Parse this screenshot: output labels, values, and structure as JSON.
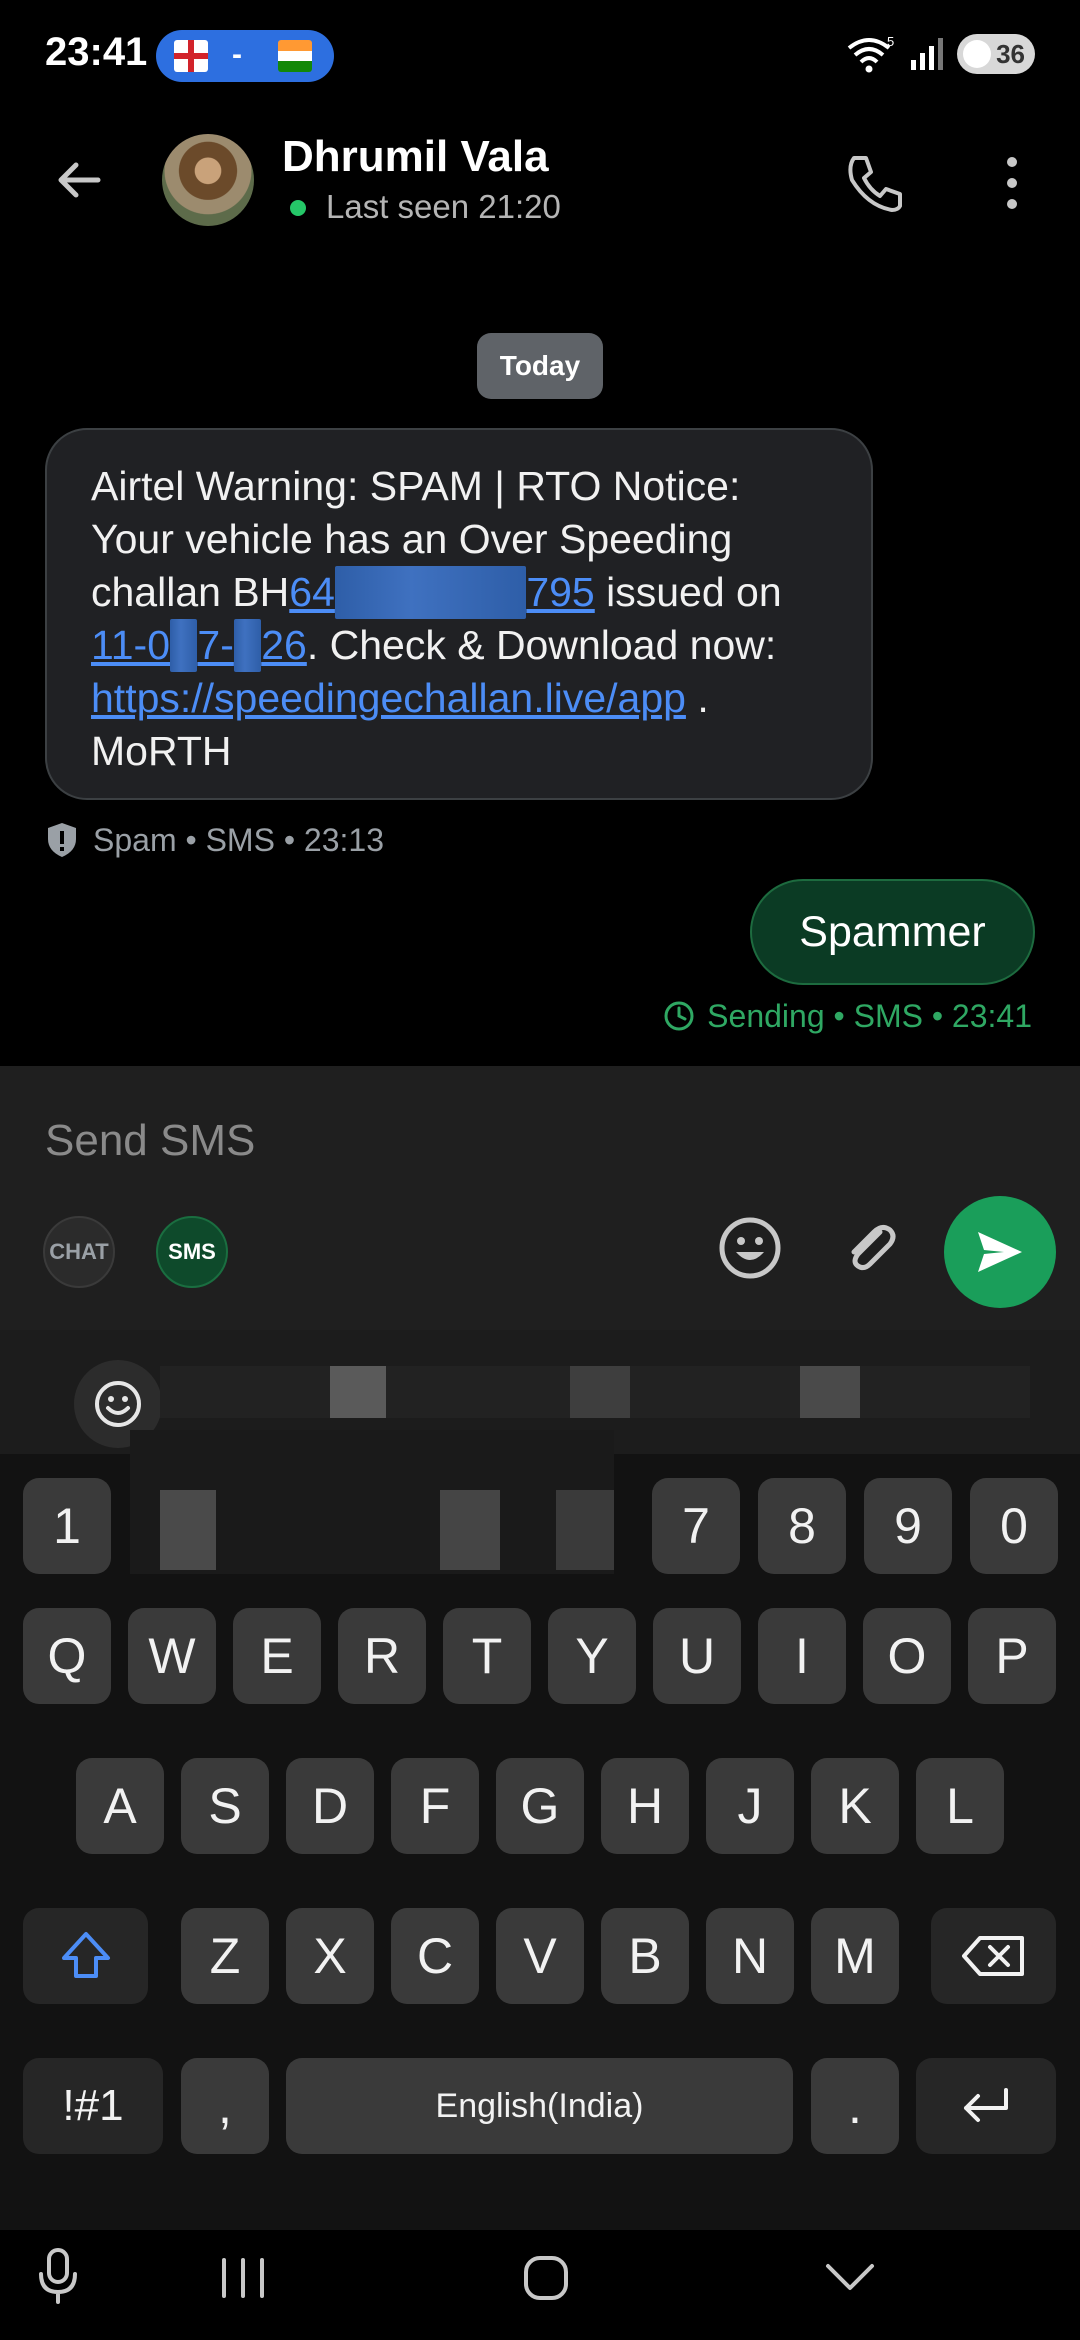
{
  "status_bar": {
    "time": "23:41",
    "match_separator": "-",
    "battery": "36"
  },
  "header": {
    "contact_name": "Dhrumil Vala",
    "last_seen": "Last seen 21:20"
  },
  "chat": {
    "date_chip": "Today",
    "incoming": {
      "line1": "Airtel Warning: SPAM | RTO Notice:",
      "line2": "Your vehicle has an Over Speeding",
      "line3_pre": "challan BH",
      "challan_visible_start": "64",
      "challan_visible_end": "795",
      "line3_post": " issued on",
      "date_visible_start": "11-0",
      "date_visible_mid": "7-",
      "date_visible_end": "26",
      "line4_post": ". Check & Download now:",
      "link": "https://speedingechallan.live/app",
      "link_post": " .",
      "line6": "MoRTH",
      "meta": "Spam • SMS • 23:13"
    },
    "outgoing": {
      "text": "Spammer",
      "meta": "Sending • SMS • 23:41"
    }
  },
  "compose": {
    "placeholder": "Send SMS",
    "chat_chip": "CHAT",
    "sms_chip": "SMS"
  },
  "keyboard": {
    "number_row": [
      "1",
      "7",
      "8",
      "9",
      "0"
    ],
    "row1": [
      "Q",
      "W",
      "E",
      "R",
      "T",
      "Y",
      "U",
      "I",
      "O",
      "P"
    ],
    "row2": [
      "A",
      "S",
      "D",
      "F",
      "G",
      "H",
      "J",
      "K",
      "L"
    ],
    "row3": [
      "Z",
      "X",
      "C",
      "V",
      "B",
      "N",
      "M"
    ],
    "symbols_key": "!#1",
    "comma_key": ",",
    "space_label": "English(India)",
    "period_key": "."
  },
  "colors": {
    "accent_green": "#1a9e5a",
    "link_blue": "#4c8df6",
    "sending_green": "#2fa863"
  }
}
